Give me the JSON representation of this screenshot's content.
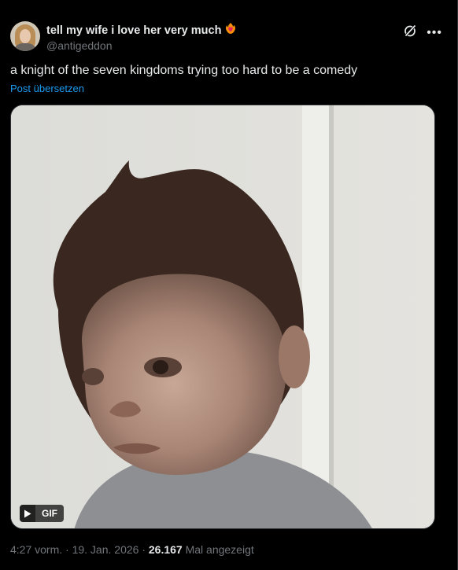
{
  "tweet": {
    "display_name": "tell my wife i love her very much",
    "handle": "@antigeddon",
    "text": "a knight of the seven kingdoms trying too hard to be a comedy",
    "translate": "Post übersetzen",
    "media_badge": "GIF",
    "timestamp": "4:27 vorm. · 19. Jan. 2026 · ",
    "views_count": "26.167",
    "views_label": " Mal angezeigt"
  },
  "icons": {
    "display_name_emoji": "heart-on-fire-icon",
    "grok": "grok-icon",
    "more": "more-icon",
    "play": "play-icon"
  },
  "colors": {
    "background": "#000000",
    "text": "#e7e9ea",
    "secondary": "#71767b",
    "link": "#1d9bf0"
  }
}
